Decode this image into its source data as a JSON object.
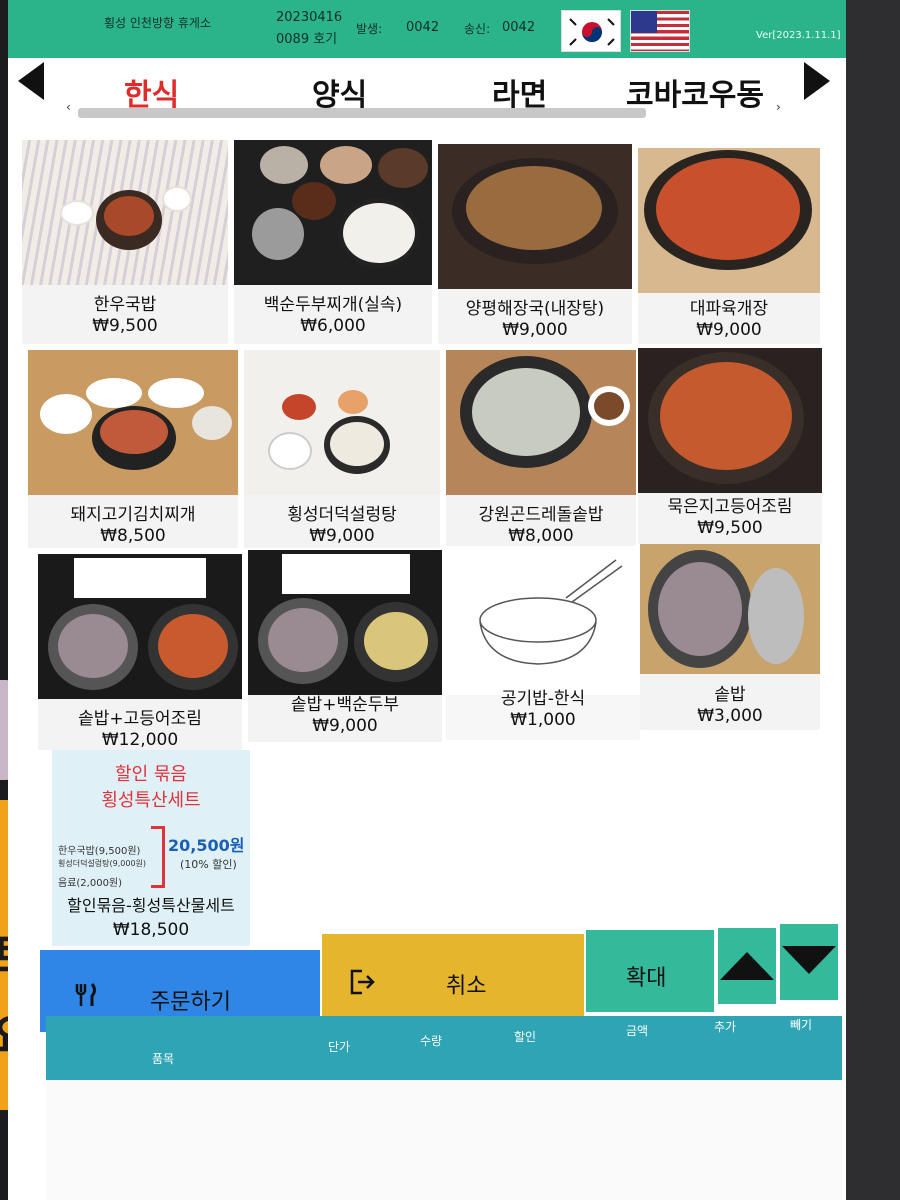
{
  "topbar": {
    "station": "횡성 인천방향 휴게소",
    "date": "20230416",
    "machine": "0089 호기",
    "issued_label": "발생:",
    "issued_value": "0042",
    "sent_label": "송신:",
    "sent_value": "0042",
    "version": "Ver[2023.1.11.1]"
  },
  "tabs": [
    {
      "label": "한식",
      "active": true
    },
    {
      "label": "양식",
      "active": false
    },
    {
      "label": "라면",
      "active": false
    },
    {
      "label": "코바코우동",
      "active": false
    }
  ],
  "menu": [
    {
      "name": "한우국밥",
      "price": "₩9,500"
    },
    {
      "name": "백순두부찌개(실속)",
      "price": "₩6,000"
    },
    {
      "name": "양평해장국(내장탕)",
      "price": "₩9,000"
    },
    {
      "name": "대파육개장",
      "price": "₩9,000"
    },
    {
      "name": "돼지고기김치찌개",
      "price": "₩8,500"
    },
    {
      "name": "횡성더덕설렁탕",
      "price": "₩9,000"
    },
    {
      "name": "강원곤드레돌솥밥",
      "price": "₩8,000"
    },
    {
      "name": "묵은지고등어조림",
      "price": "₩9,500"
    },
    {
      "name": "솥밥+고등어조림",
      "price": "₩12,000"
    },
    {
      "name": "솥밥+백순두부",
      "price": "₩9,000"
    },
    {
      "name": "공기밥-한식",
      "price": "₩1,000"
    },
    {
      "name": "솥밥",
      "price": "₩3,000"
    },
    {
      "name": "할인묶음-횡성특산물세트",
      "price": "₩18,500"
    }
  ],
  "promo": {
    "line1": "할인 묶음",
    "line2": "횡성특산세트",
    "item1": "한우국밥(9,500원)",
    "item2": "횡성더덕설렁탕(9,000원)",
    "item3": "음료(2,000원)",
    "total": "20,500원",
    "discount": "(10% 할인)"
  },
  "actions": {
    "order": "주문하기",
    "cancel": "취소",
    "zoom": "확대"
  },
  "table_headers": [
    "품목",
    "단가",
    "수량",
    "할인",
    "금액",
    "추가",
    "빼기"
  ],
  "colors": {
    "topbar": "#2bb38a",
    "active_tab": "#e02b2b",
    "order_button": "#2f86e6",
    "cancel_button": "#e5b62d",
    "zoom_button": "#35b99b",
    "arrow_button": "#35b99b",
    "table_header": "#2ea4b4"
  },
  "icons": {
    "order": "fork-knife-icon",
    "cancel": "exit-icon",
    "up": "triangle-up-icon",
    "down": "triangle-down-icon"
  }
}
